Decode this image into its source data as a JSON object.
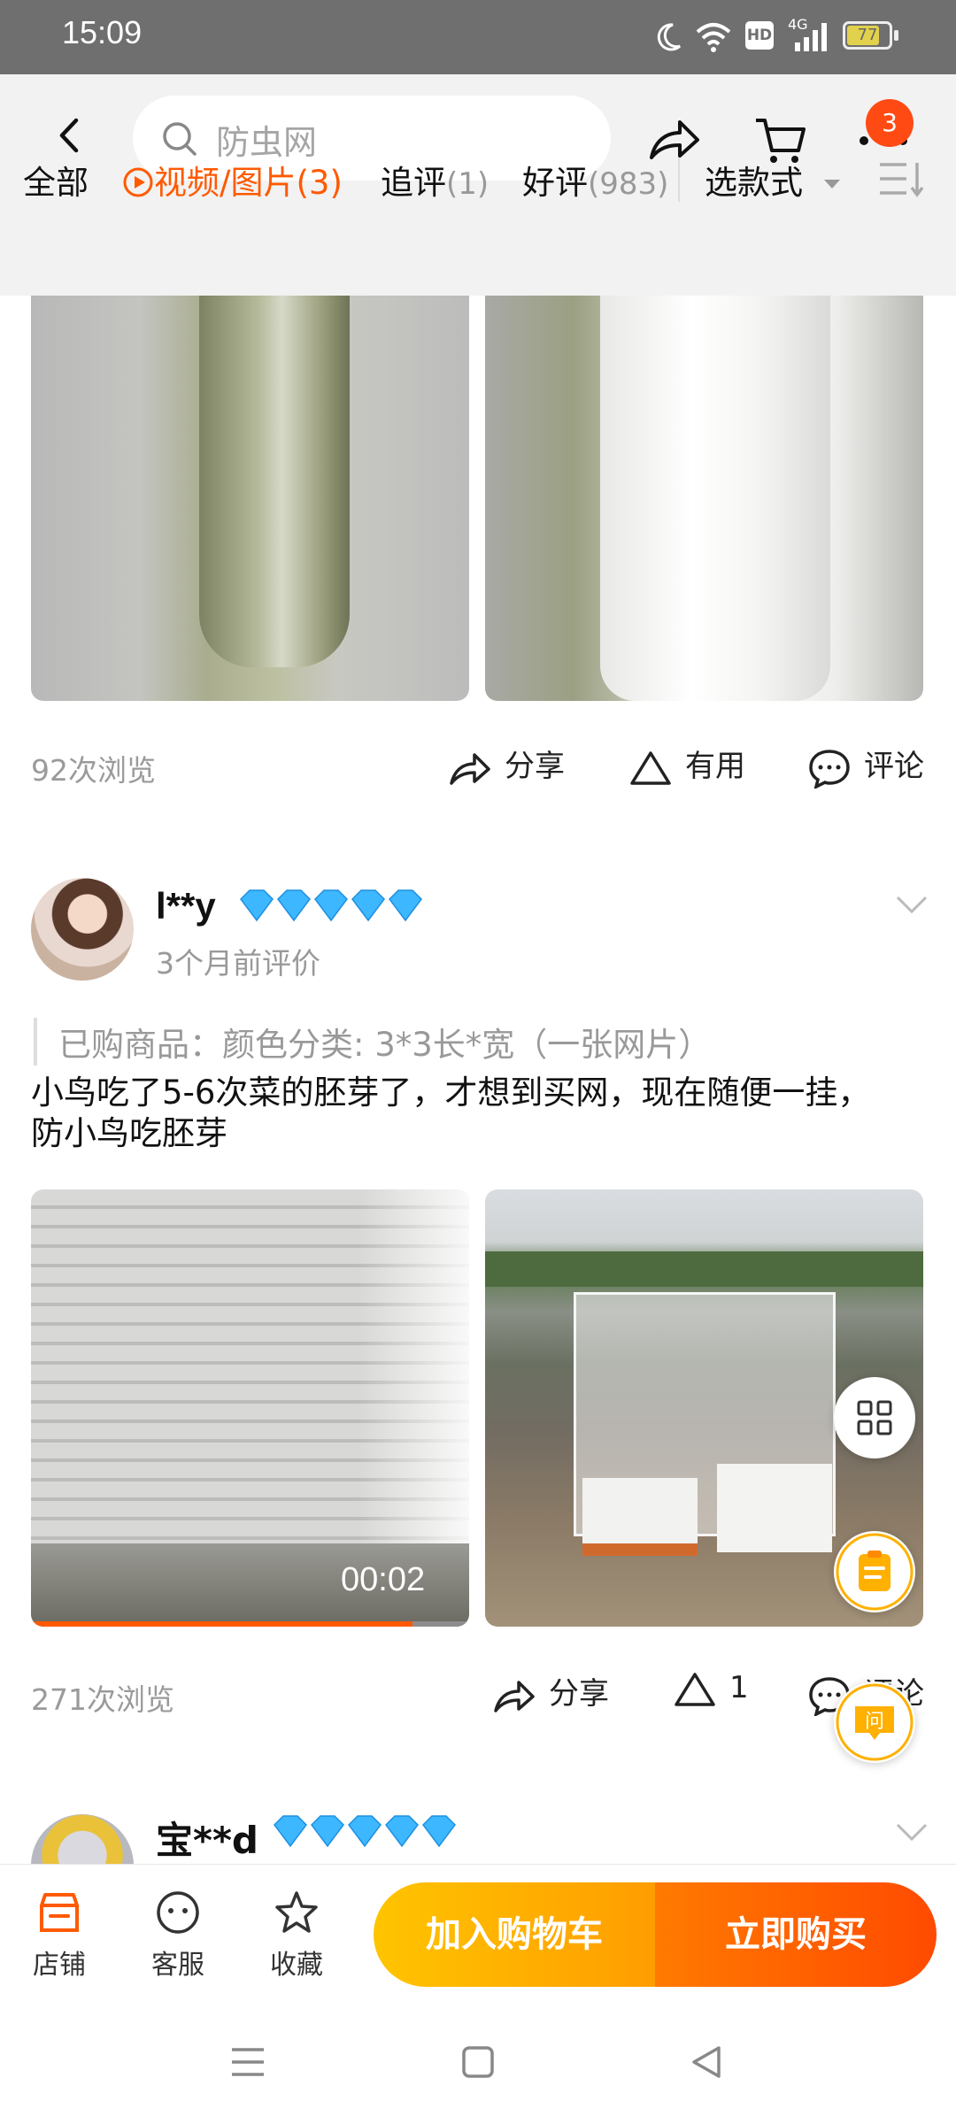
{
  "status_bar": {
    "time": "15:09",
    "battery": "77",
    "network": "4G",
    "hd": "HD"
  },
  "header": {
    "search_placeholder": "防虫网",
    "cart_badge": "3"
  },
  "tabs": {
    "all": "全部",
    "media_label": "视频/图片",
    "media_count": "(3)",
    "followup_label": "追评",
    "followup_count": "(1)",
    "good_label": "好评",
    "good_count": "(983)",
    "style_label": "选款式"
  },
  "review1": {
    "views": "92次浏览",
    "share": "分享",
    "useful": "有用",
    "comment": "评论"
  },
  "review2": {
    "username": "l**y",
    "date": "3个月前评价",
    "purchase": "已购商品：颜色分类: 3*3长*宽（一张网片）",
    "text": "小鸟吃了5-6次菜的胚芽了，才想到买网，现在随便一挂，防小鸟吃胚芽",
    "video_duration": "00:02",
    "video_progress": 0.87,
    "views": "271次浏览",
    "share": "分享",
    "useful_count": "1",
    "comment": "评论"
  },
  "review3": {
    "username": "宝**d"
  },
  "bottom_bar": {
    "shop": "店铺",
    "service": "客服",
    "favorite": "收藏",
    "add_to_cart": "加入购物车",
    "buy_now": "立即购买"
  },
  "floating": {
    "ask": "问"
  },
  "colors": {
    "accent": "#ff5a00",
    "badge": "#ff4a14",
    "cart_btn": "#ffb300",
    "buy_btn": "#ff5a00",
    "gem": "#3db7ff"
  }
}
